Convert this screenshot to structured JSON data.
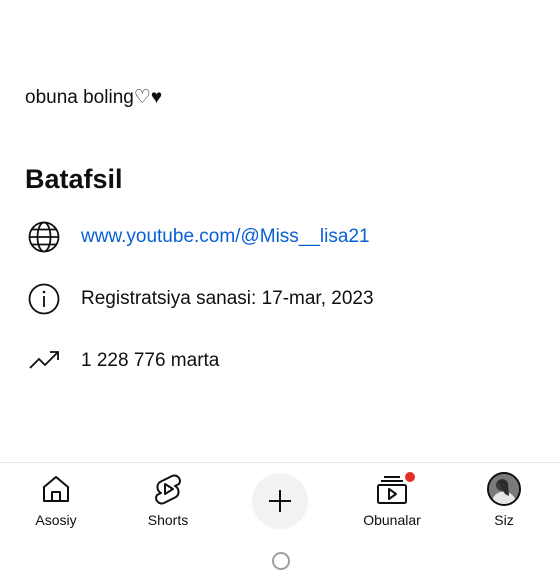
{
  "about": {
    "description": "obuna boling♡♥",
    "heading": "Batafsil",
    "link": "www.youtube.com/@Miss__lisa21",
    "registration": "Registratsiya sanasi: 17-mar, 2023",
    "views": "1 228 776 marta"
  },
  "nav": {
    "home": "Asosiy",
    "shorts": "Shorts",
    "subscriptions": "Obunalar",
    "you": "Siz"
  },
  "colors": {
    "link": "#065fd4",
    "badge": "#e52d27"
  }
}
